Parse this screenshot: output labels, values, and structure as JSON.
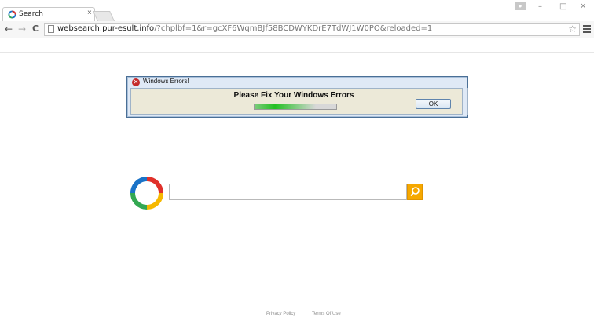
{
  "browser": {
    "tab": {
      "title": "Search",
      "close_glyph": "×"
    },
    "window_controls": {
      "minimize": "–",
      "maximize": "□",
      "close": "✕"
    },
    "toolbar": {
      "back_glyph": "←",
      "forward_glyph": "→",
      "reload_glyph": "C",
      "url_host": "websearch.pur-esult.info",
      "url_rest": "/?chplbf=1&r=gcXF6WqmBJf58BCDWYKDrE7TdWJ1W0PO&reloaded=1",
      "star_glyph": "☆"
    }
  },
  "dialog": {
    "title": "Windows Errors!",
    "error_glyph": "✕",
    "message": "Please Fix Your Windows Errors",
    "ok_label": "OK",
    "progress_fraction": 0.5
  },
  "search": {
    "input_value": "",
    "button_icon": "search-icon"
  },
  "footer": {
    "privacy_label": "Privacy Policy",
    "terms_label": "Terms Of Use"
  },
  "colors": {
    "search_button": "#f6a800",
    "logo_blue": "#1a73c8",
    "logo_red": "#e0312b",
    "logo_yellow": "#f6b800",
    "logo_green": "#33a852",
    "dialog_error": "#c42a2a"
  }
}
